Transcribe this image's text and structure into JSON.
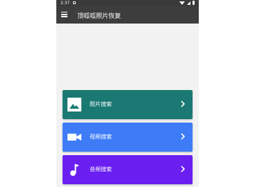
{
  "status": {
    "time": "2:37"
  },
  "appbar": {
    "title": "顶呱呱照片恢复"
  },
  "cards": [
    {
      "label": "照片搜索",
      "color": "#1a7a73",
      "icon": "image-icon"
    },
    {
      "label": "视频搜索",
      "color": "#3d7cf6",
      "icon": "video-camera-icon"
    },
    {
      "label": "音频搜索",
      "color": "#6a1ff0",
      "icon": "music-note-icon"
    }
  ]
}
